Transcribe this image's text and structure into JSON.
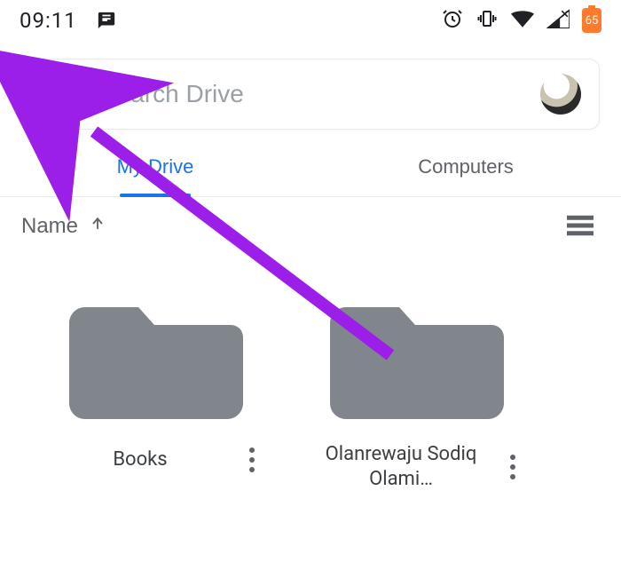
{
  "statusbar": {
    "time": "09:11",
    "battery_level": "65"
  },
  "search": {
    "placeholder": "Search Drive"
  },
  "tabs": {
    "my_drive": "My Drive",
    "computers": "Computers"
  },
  "sort": {
    "label": "Name"
  },
  "folders": [
    {
      "name": "Books"
    },
    {
      "name": "Olanrewaju Sodiq Olami…"
    }
  ]
}
